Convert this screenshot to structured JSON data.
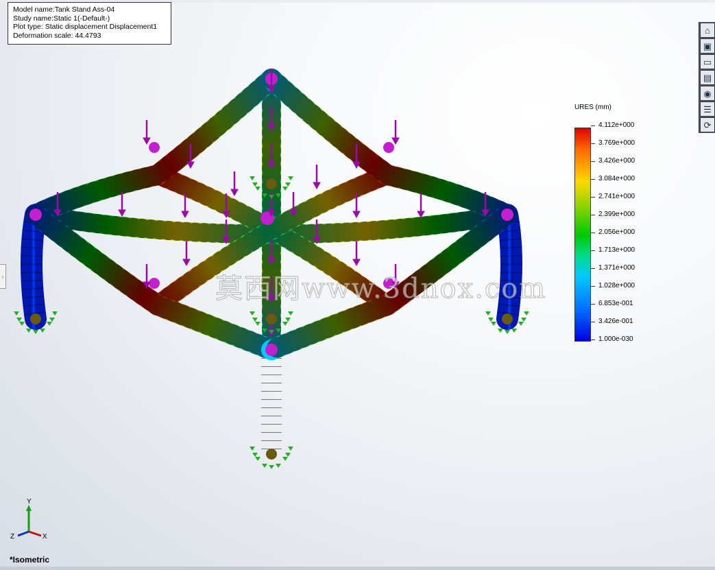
{
  "info": {
    "model_name": "Model name:Tank Stand Ass-04",
    "study_name": "Study name:Static 1(-Default-)",
    "plot_type": "Plot type: Static displacement Displacement1",
    "deformation_scale": "Deformation scale: 44.4793"
  },
  "legend": {
    "title": "URES (mm)",
    "labels": [
      "4.112e+000",
      "3.769e+000",
      "3.426e+000",
      "3.084e+000",
      "2.741e+000",
      "2.399e+000",
      "2.056e+000",
      "1.713e+000",
      "1.371e+000",
      "1.028e+000",
      "6.853e-001",
      "3.426e-001",
      "1.000e-030"
    ]
  },
  "view": {
    "name": "*Isometric"
  },
  "triad": {
    "x": "X",
    "y": "Y",
    "z": "Z"
  },
  "watermark": "莫西网www.3dnox.com",
  "toolbar": {
    "icons": [
      "home-icon",
      "part-icon",
      "folder-icon",
      "properties-icon",
      "appearance-icon",
      "list-icon",
      "refresh-icon"
    ],
    "glyphs": [
      "⌂",
      "▣",
      "▭",
      "▤",
      "◉",
      "☰",
      "⟳"
    ]
  },
  "colors": {
    "max": "#e00000",
    "high": "#ffd800",
    "mid": "#00c800",
    "low": "#00c8ff",
    "min": "#0000e0",
    "load_arrow": "#9a0aa8",
    "fixture": "#22b022"
  }
}
